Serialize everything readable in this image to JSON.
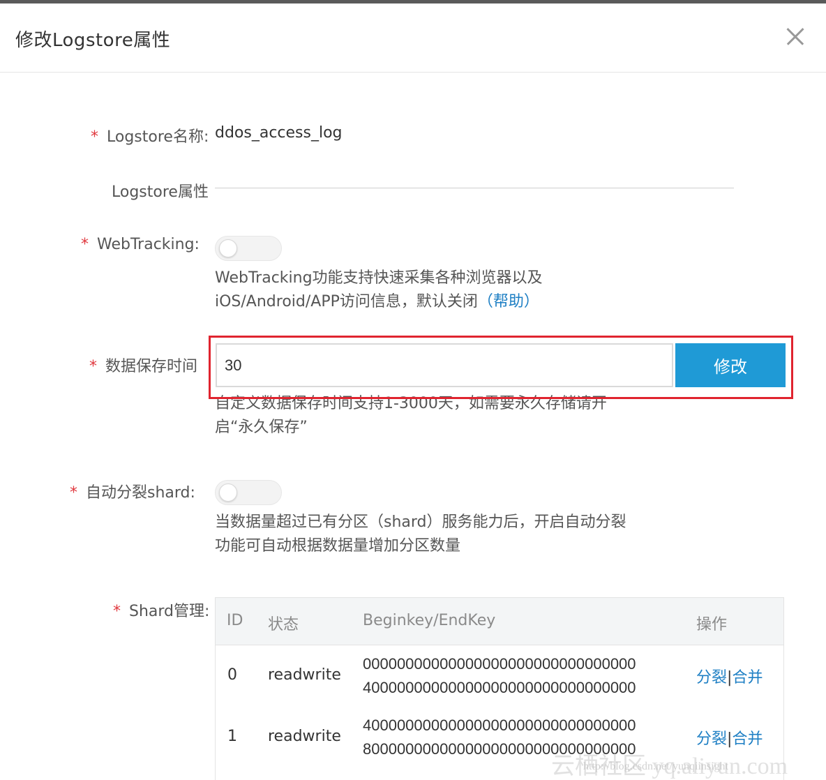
{
  "dialog": {
    "title": "修改Logstore属性",
    "close_icon": "close-icon"
  },
  "form": {
    "required_mark": "*",
    "name_label": "Logstore名称:",
    "name_value": "ddos_access_log",
    "section_title": "Logstore属性",
    "webtracking": {
      "label": "WebTracking:",
      "enabled": false,
      "help_line1": "WebTracking功能支持快速采集各种浏览器以及",
      "help_line2": "iOS/Android/APP访问信息，默认关闭",
      "help_link": "（帮助）"
    },
    "retention": {
      "label": "数据保存时间",
      "value": "30",
      "button": "修改",
      "help_line1": "自定义数据保存时间支持1-3000天，如需要永久存储请开",
      "help_line2": "启“永久保存”"
    },
    "auto_split": {
      "label": "自动分裂shard:",
      "enabled": false,
      "help_line1": "当数据量超过已有分区（shard）服务能力后，开启自动分裂",
      "help_line2": "功能可自动根据数据量增加分区数量"
    },
    "shard": {
      "label": "Shard管理:",
      "columns": [
        "ID",
        "状态",
        "Beginkey/EndKey",
        "操作"
      ],
      "rows": [
        {
          "id": "0",
          "status": "readwrite",
          "begin_key": "00000000000000000000000000000000",
          "end_key": "40000000000000000000000000000000",
          "op_split": "分裂",
          "op_sep": "|",
          "op_merge": "合并"
        },
        {
          "id": "1",
          "status": "readwrite",
          "begin_key": "40000000000000000000000000000000",
          "end_key": "80000000000000000000000000000000",
          "op_split": "分裂",
          "op_sep": "|",
          "op_merge": "合并"
        }
      ]
    }
  },
  "watermark": {
    "main": "云栖社区 yq.aliyun.com",
    "sub": "http://blog.csdn.net/yunqiinsight"
  }
}
